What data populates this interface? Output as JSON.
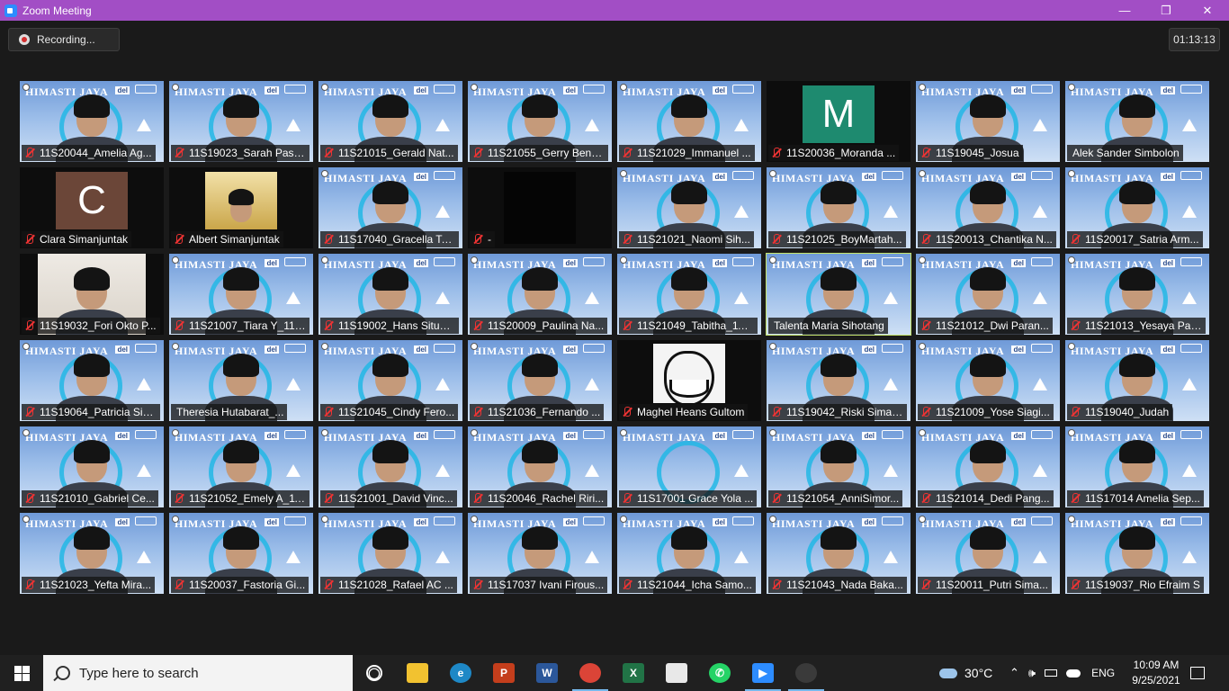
{
  "window": {
    "title": "Zoom Meeting",
    "minimize": "—",
    "maximize": "❐",
    "close": "✕"
  },
  "recording": {
    "label": "Recording..."
  },
  "timer": "01:13:13",
  "participants": [
    {
      "name": "11S20044_Amelia Ag...",
      "muted": true,
      "feed": "himasti-person"
    },
    {
      "name": "11S19023_Sarah Pasa...",
      "muted": true,
      "feed": "himasti-person"
    },
    {
      "name": "11S21015_Gerald Nat...",
      "muted": true,
      "feed": "himasti-person"
    },
    {
      "name": "11S21055_Gerry Beny...",
      "muted": true,
      "feed": "himasti-person"
    },
    {
      "name": "11S21029_Immanuel ...",
      "muted": true,
      "feed": "himasti-person"
    },
    {
      "name": "11S20036_Moranda ...",
      "muted": true,
      "feed": "letter",
      "letter": "M",
      "color": "#1e8a6f"
    },
    {
      "name": "11S19045_Josua",
      "muted": true,
      "feed": "himasti-person"
    },
    {
      "name": "Alek Sander Simbolon",
      "muted": false,
      "feed": "himasti-person"
    },
    {
      "name": "Clara Simanjuntak",
      "muted": true,
      "feed": "letter",
      "letter": "C",
      "color": "#6b4638"
    },
    {
      "name": "Albert Simanjuntak",
      "muted": true,
      "feed": "temple"
    },
    {
      "name": "11S17040_Gracella Ta...",
      "muted": true,
      "feed": "himasti-person"
    },
    {
      "name": "-",
      "muted": true,
      "feed": "black"
    },
    {
      "name": "11S21021_Naomi Sih...",
      "muted": true,
      "feed": "himasti-person"
    },
    {
      "name": "11S21025_BoyMartah...",
      "muted": true,
      "feed": "himasti-person"
    },
    {
      "name": "11S20013_Chantika N...",
      "muted": true,
      "feed": "himasti-person"
    },
    {
      "name": "11S20017_Satria Arm...",
      "muted": true,
      "feed": "himasti-person"
    },
    {
      "name": "11S19032_Fori Okto P...",
      "muted": true,
      "feed": "room"
    },
    {
      "name": "11S21007_Tiara Y_11I...",
      "muted": true,
      "feed": "himasti-person"
    },
    {
      "name": "11S19002_Hans Situm...",
      "muted": true,
      "feed": "himasti-person"
    },
    {
      "name": "11S20009_Paulina Na...",
      "muted": true,
      "feed": "himasti-person"
    },
    {
      "name": "11S21049_Tabitha_11I...",
      "muted": true,
      "feed": "himasti-person"
    },
    {
      "name": "Talenta Maria Sihotang",
      "muted": false,
      "feed": "himasti-person",
      "active": true
    },
    {
      "name": "11S21012_Dwi Paran...",
      "muted": true,
      "feed": "himasti-person"
    },
    {
      "name": "11S21013_Yesaya Par...",
      "muted": true,
      "feed": "himasti-person"
    },
    {
      "name": "11S19064_Patricia Sib...",
      "muted": true,
      "feed": "himasti-person"
    },
    {
      "name": "Theresia Hutabarat_...",
      "muted": false,
      "feed": "himasti-person"
    },
    {
      "name": "11S21045_Cindy Fero...",
      "muted": true,
      "feed": "himasti-person"
    },
    {
      "name": "11S21036_Fernando ...",
      "muted": true,
      "feed": "himasti-person"
    },
    {
      "name": "Maghel Heans Gultom",
      "muted": true,
      "feed": "troll"
    },
    {
      "name": "11S19042_Riski Siman...",
      "muted": true,
      "feed": "himasti-person"
    },
    {
      "name": "11S21009_Yose Siagi...",
      "muted": true,
      "feed": "himasti-person"
    },
    {
      "name": "11S19040_Judah",
      "muted": true,
      "feed": "himasti-person"
    },
    {
      "name": "11S21010_Gabriel Ce...",
      "muted": true,
      "feed": "himasti-person"
    },
    {
      "name": "11S21052_Emely A_11...",
      "muted": true,
      "feed": "himasti-person"
    },
    {
      "name": "11S21001_David Vinc...",
      "muted": true,
      "feed": "himasti-person"
    },
    {
      "name": "11S20046_Rachel Riri...",
      "muted": true,
      "feed": "himasti-person"
    },
    {
      "name": "11S17001 Grace Yola ...",
      "muted": true,
      "feed": "himasti"
    },
    {
      "name": "11S21054_AnniSimor...",
      "muted": true,
      "feed": "himasti-person"
    },
    {
      "name": "11S21014_Dedi Pang...",
      "muted": true,
      "feed": "himasti-person"
    },
    {
      "name": "11S17014 Amelia Sep...",
      "muted": true,
      "feed": "himasti-person"
    },
    {
      "name": "11S21023_Yefta Mira...",
      "muted": true,
      "feed": "himasti-person"
    },
    {
      "name": "11S20037_Fastoria Gi...",
      "muted": true,
      "feed": "himasti-person"
    },
    {
      "name": "11S21028_Rafael AC ...",
      "muted": true,
      "feed": "himasti-person"
    },
    {
      "name": "11S17037 Ivani Firous...",
      "muted": true,
      "feed": "himasti-person"
    },
    {
      "name": "11S21044_Icha Samo...",
      "muted": true,
      "feed": "himasti-person"
    },
    {
      "name": "11S21043_Nada Baka...",
      "muted": true,
      "feed": "himasti-person"
    },
    {
      "name": "11S20011_Putri Sima...",
      "muted": true,
      "feed": "himasti-person"
    },
    {
      "name": "11S19037_Rio Efraim S",
      "muted": true,
      "feed": "himasti-person"
    }
  ],
  "background_brand": {
    "text": "HIMASTI JAYA",
    "badge": "del"
  },
  "taskbar": {
    "search_placeholder": "Type here to search",
    "apps": [
      {
        "name": "cortana-icon",
        "glyph": "◯",
        "color": "#202020"
      },
      {
        "name": "file-explorer-icon",
        "glyph": "",
        "color": "#f2c230"
      },
      {
        "name": "edge-icon",
        "glyph": "e",
        "color": "#1e88c6"
      },
      {
        "name": "powerpoint-icon",
        "glyph": "P",
        "color": "#c43e1c"
      },
      {
        "name": "word-icon",
        "glyph": "W",
        "color": "#2b579a"
      },
      {
        "name": "chrome-icon",
        "glyph": "",
        "color": "#db4437"
      },
      {
        "name": "excel-icon",
        "glyph": "X",
        "color": "#217346"
      },
      {
        "name": "snip-icon",
        "glyph": "",
        "color": "#e8e8e8"
      },
      {
        "name": "whatsapp-icon",
        "glyph": "✆",
        "color": "#25d366"
      },
      {
        "name": "zoom-icon",
        "glyph": "▶",
        "color": "#2d8cff"
      },
      {
        "name": "obs-icon",
        "glyph": "",
        "color": "#3a3a3a"
      }
    ],
    "weather": "30°C",
    "language": "ENG",
    "time": "10:09 AM",
    "date": "9/25/2021"
  }
}
